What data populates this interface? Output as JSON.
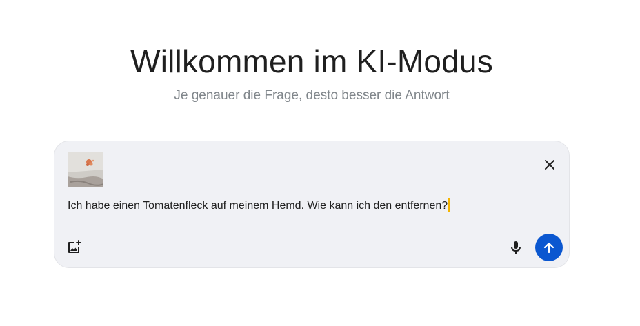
{
  "header": {
    "title": "Willkommen im KI-Modus",
    "subtitle": "Je genauer die Frage, desto besser die Antwort"
  },
  "composer": {
    "query": "Ich habe einen Tomatenfleck auf meinem Hemd. Wie kann ich den entfernen?",
    "attachment_icon": "image-thumbnail",
    "close_icon": "close-icon",
    "add_image_icon": "add-image-icon",
    "mic_icon": "mic-icon",
    "send_icon": "arrow-up-icon"
  },
  "colors": {
    "accent": "#0b57d0",
    "composer_bg": "#f0f1f5",
    "caret": "#f5b400",
    "subtitle": "#80868b"
  }
}
